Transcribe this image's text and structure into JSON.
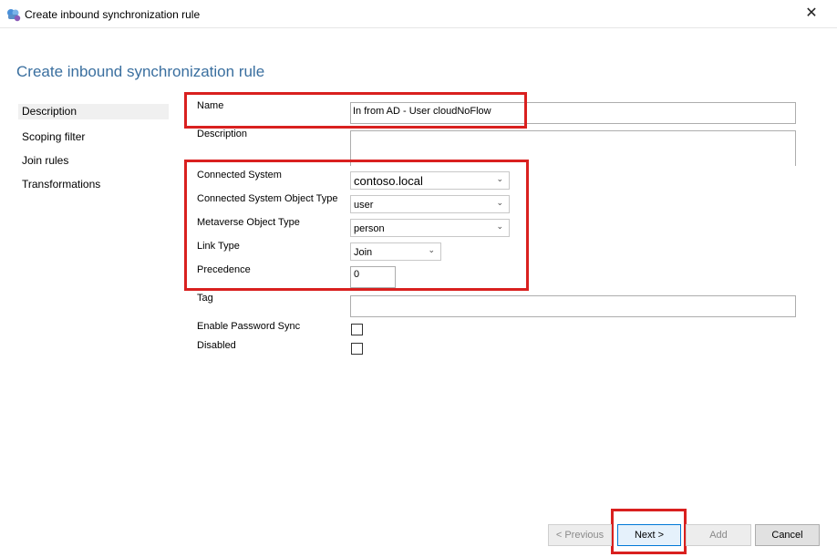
{
  "window": {
    "title": "Create inbound synchronization rule"
  },
  "page": {
    "title": "Create inbound synchronization rule"
  },
  "nav": {
    "items": [
      {
        "label": "Description",
        "active": true
      },
      {
        "label": "Scoping filter"
      },
      {
        "label": "Join rules"
      },
      {
        "label": "Transformations"
      }
    ]
  },
  "form": {
    "name": {
      "label": "Name",
      "value": "In from AD - User cloudNoFlow"
    },
    "description": {
      "label": "Description",
      "value": ""
    },
    "connected_system": {
      "label": "Connected System",
      "value": "contoso.local"
    },
    "connected_system_object_type": {
      "label": "Connected System Object Type",
      "value": "user"
    },
    "metaverse_object_type": {
      "label": "Metaverse Object Type",
      "value": "person"
    },
    "link_type": {
      "label": "Link Type",
      "value": "Join"
    },
    "precedence": {
      "label": "Precedence",
      "value": "0"
    },
    "tag": {
      "label": "Tag",
      "value": ""
    },
    "enable_password_sync": {
      "label": "Enable Password Sync",
      "checked": false
    },
    "disabled": {
      "label": "Disabled",
      "checked": false
    }
  },
  "buttons": {
    "previous": "< Previous",
    "next": "Next >",
    "add": "Add",
    "cancel": "Cancel"
  },
  "colors": {
    "highlight": "#d9201f",
    "title": "#3a6f9f"
  }
}
